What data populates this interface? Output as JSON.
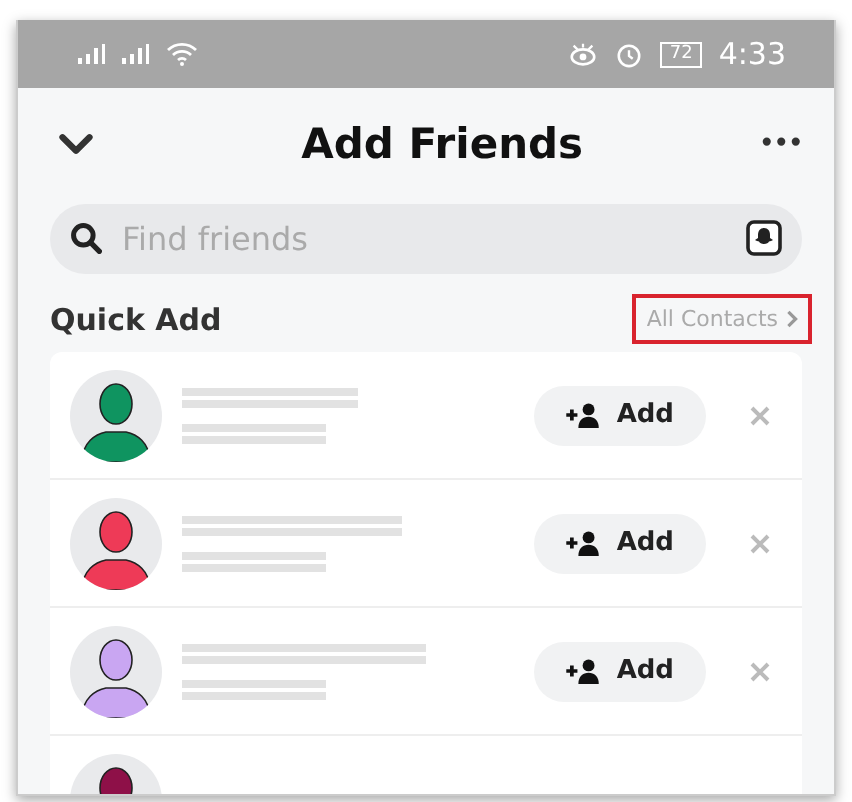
{
  "status_bar": {
    "battery": "72",
    "time": "4:33"
  },
  "header": {
    "title": "Add Friends",
    "more": "•••"
  },
  "search": {
    "placeholder": "Find friends"
  },
  "section": {
    "title": "Quick Add",
    "link": {
      "label": "All Contacts",
      "highlighted": true
    }
  },
  "suggestions": [
    {
      "color": "#0f9460",
      "redacted": true,
      "button": "Add"
    },
    {
      "color": "#ee3a57",
      "redacted": true,
      "button": "Add"
    },
    {
      "color": "#c9a6f2",
      "redacted": true,
      "button": "Add"
    },
    {
      "color": "#8e1048",
      "redacted": false
    }
  ]
}
